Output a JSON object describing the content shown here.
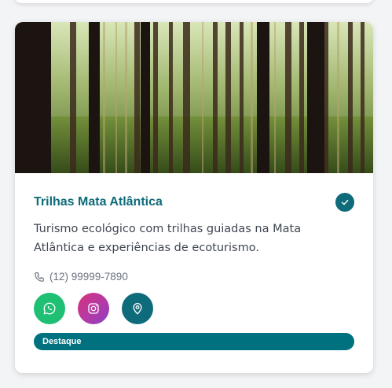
{
  "card": {
    "title": "Trilhas Mata Atlântica",
    "description": "Turismo ecológico com trilhas guiadas na Mata Atlântica e experiências de ecoturismo.",
    "phone": "(12) 99999-7890",
    "badge": "Destaque",
    "verified_icon": "check-icon",
    "phone_icon": "phone-icon",
    "social_icons": [
      "whatsapp-icon",
      "instagram-icon",
      "map-pin-icon"
    ],
    "colors": {
      "accent": "#0e6b7a",
      "whatsapp": "#1fbf74",
      "instagram": "#c1359a",
      "badge": "#00717f"
    }
  }
}
